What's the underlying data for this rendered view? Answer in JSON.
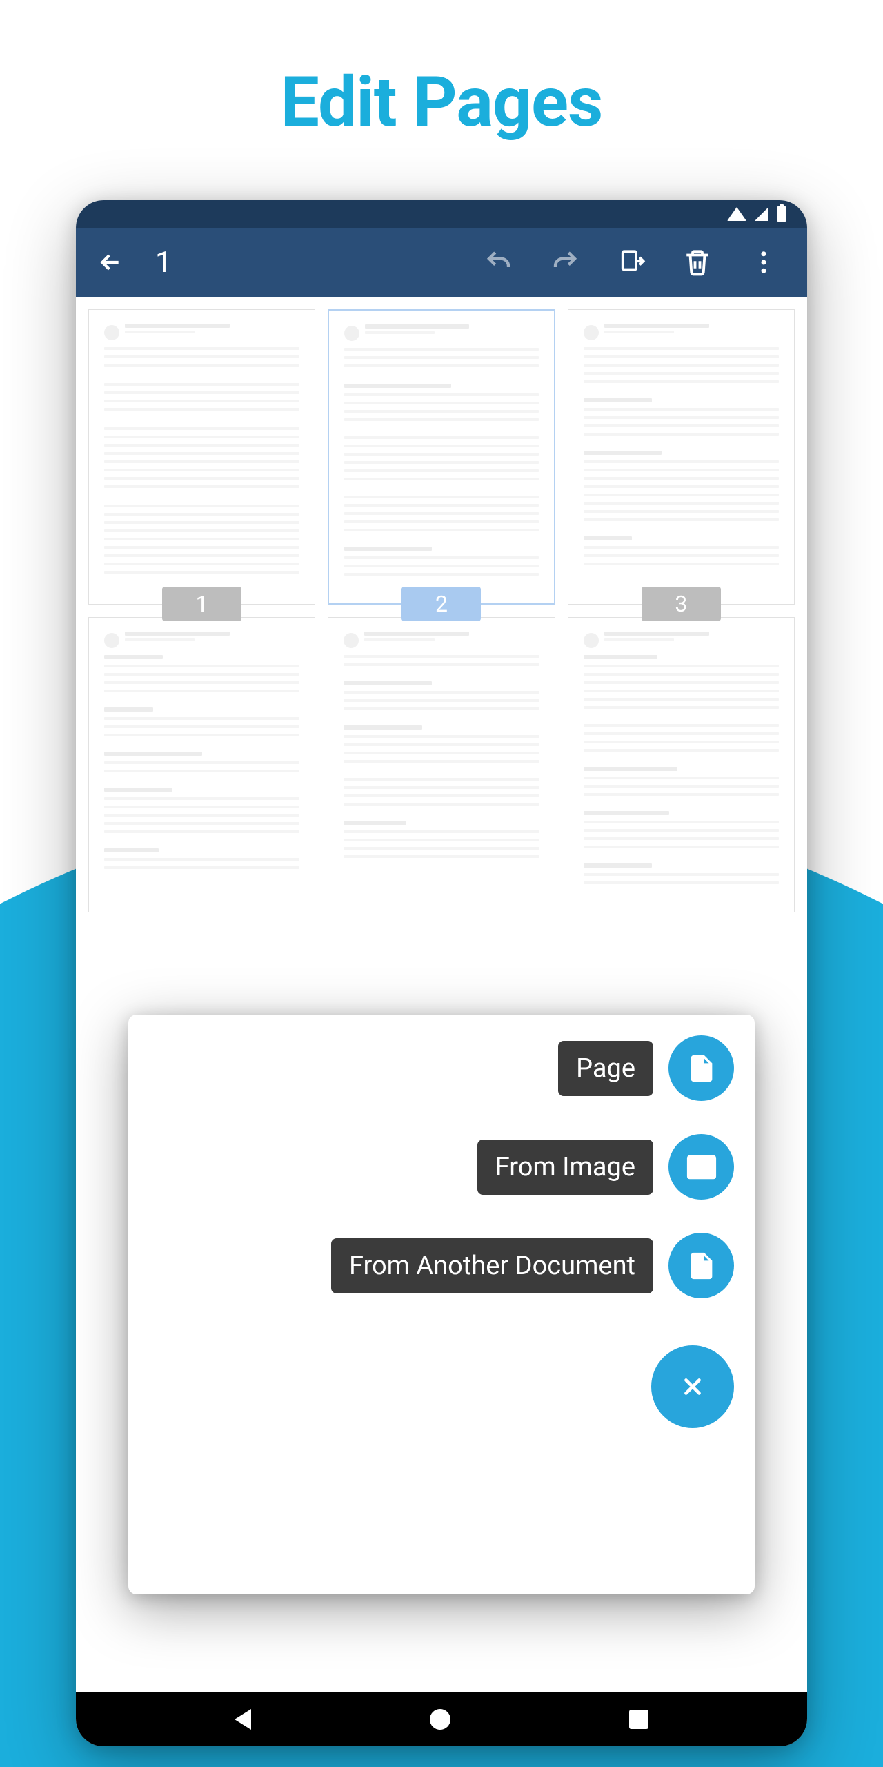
{
  "title": "Edit Pages",
  "toolbar": {
    "page_number": "1"
  },
  "pages": {
    "p1": "1",
    "p2": "2",
    "p3": "3"
  },
  "fab": {
    "page": "Page",
    "from_image": "From Image",
    "from_doc": "From Another Document"
  },
  "colors": {
    "accent": "#1baedc",
    "toolbar_bg": "#2a4e78",
    "fab_blue": "#28a5dc"
  }
}
